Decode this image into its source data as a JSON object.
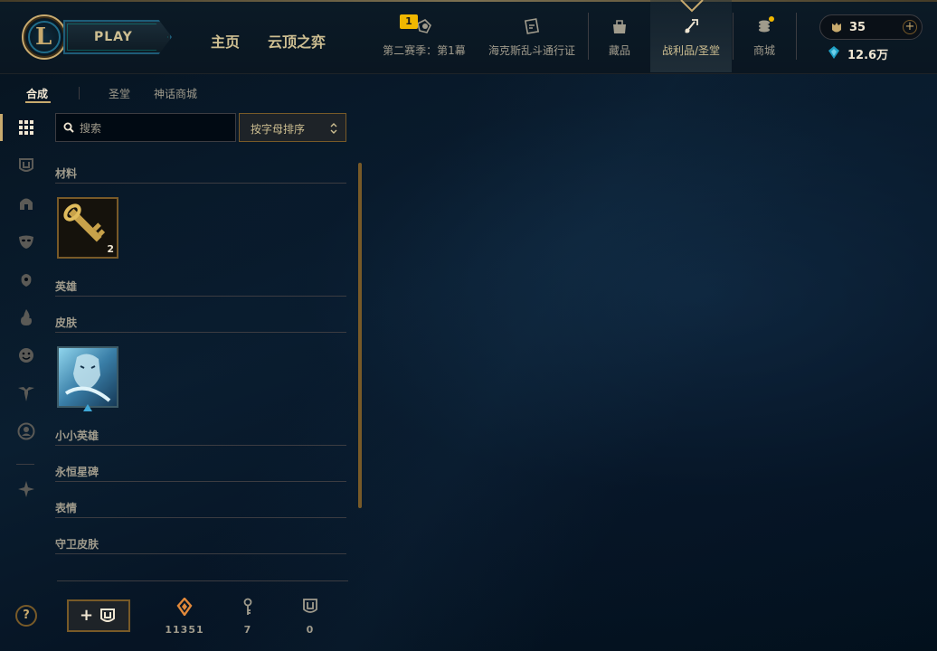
{
  "header": {
    "play_label": "PLAY",
    "nav_links": {
      "home": "主页",
      "tft": "云顶之弈"
    },
    "nav_items": {
      "season": "第二赛季：第1幕",
      "pass": "海克斯乱斗通行证",
      "collection": "藏品",
      "loot": "战利品/圣堂",
      "store": "商城"
    },
    "season_badge": "1",
    "rp": "35",
    "be": "12.6万"
  },
  "subtabs": {
    "craft": "合成",
    "sanctum": "圣堂",
    "mythic": "神话商城"
  },
  "search": {
    "placeholder": "搜索"
  },
  "sort": {
    "label": "按字母排序"
  },
  "sections": {
    "materials": "材料",
    "champions": "英雄",
    "skins": "皮肤",
    "little_legends": "小小英雄",
    "eternals": "永恒星碑",
    "emotes": "表情",
    "ward_skins": "守卫皮肤"
  },
  "items": {
    "key_fragment_count": "2"
  },
  "help_label": "?",
  "stats": {
    "orange_essence": "11351",
    "keys": "7",
    "chests": "0"
  },
  "colors": {
    "gold": "#c8aa6e",
    "accent_teal": "#0ac8b9",
    "background": "#010a13"
  }
}
